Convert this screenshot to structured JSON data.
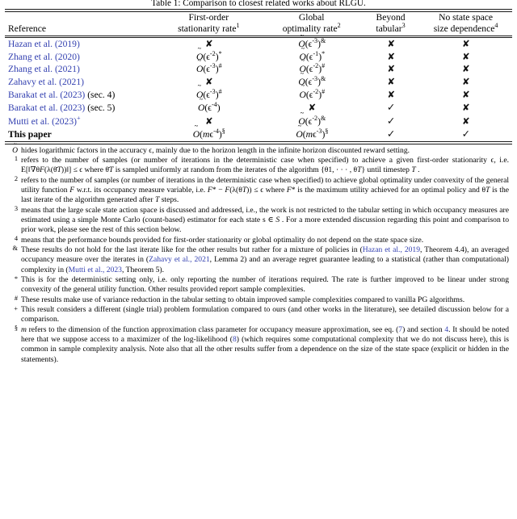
{
  "caption": "Table 1: Comparison to closest related works about RLGU.",
  "table": {
    "headers": [
      {
        "line1": "Reference",
        "line2": ""
      },
      {
        "line1": "First-order",
        "line2": "stationarity rate",
        "note": "1"
      },
      {
        "line1": "Global",
        "line2": "optimality rate",
        "note": "2"
      },
      {
        "line1": "Beyond",
        "line2": "tabular",
        "note": "3"
      },
      {
        "line1": "No state space",
        "line2": "size dependence",
        "note": "4"
      }
    ],
    "rows": [
      {
        "reference": "Hazan et al. (2019)",
        "reference_style": "link",
        "first_order": {
          "kind": "cross"
        },
        "global": {
          "kind": "rate",
          "exp": "-3",
          "note": "&"
        },
        "beyond_tabular": {
          "kind": "cross"
        },
        "no_state_dep": {
          "kind": "cross"
        }
      },
      {
        "reference": "Zhang et al. (2020)",
        "reference_style": "link",
        "first_order": {
          "kind": "rate",
          "exp": "-2",
          "note": "*"
        },
        "global": {
          "kind": "rate",
          "exp": "-1",
          "note": "*"
        },
        "beyond_tabular": {
          "kind": "cross"
        },
        "no_state_dep": {
          "kind": "cross"
        }
      },
      {
        "reference": "Zhang et al. (2021)",
        "reference_style": "link",
        "first_order": {
          "kind": "rate",
          "exp": "-3",
          "note": "#"
        },
        "global": {
          "kind": "rate",
          "exp": "-2",
          "note": "#"
        },
        "beyond_tabular": {
          "kind": "cross"
        },
        "no_state_dep": {
          "kind": "cross"
        }
      },
      {
        "reference": "Zahavy et al. (2021)",
        "reference_style": "link",
        "first_order": {
          "kind": "cross"
        },
        "global": {
          "kind": "rate",
          "exp": "-3",
          "note": "&"
        },
        "beyond_tabular": {
          "kind": "cross"
        },
        "no_state_dep": {
          "kind": "cross"
        }
      },
      {
        "reference": "Barakat et al. (2023)",
        "reference_suffix": " (sec. 4)",
        "reference_style": "link",
        "first_order": {
          "kind": "rate",
          "exp": "-3",
          "note": "#"
        },
        "global": {
          "kind": "rate",
          "exp": "-2",
          "note": "#"
        },
        "beyond_tabular": {
          "kind": "cross"
        },
        "no_state_dep": {
          "kind": "cross"
        }
      },
      {
        "reference": "Barakat et al. (2023)",
        "reference_suffix": " (sec. 5)",
        "reference_style": "link",
        "first_order": {
          "kind": "rate",
          "exp": "-4",
          "note": ""
        },
        "global": {
          "kind": "cross"
        },
        "beyond_tabular": {
          "kind": "check"
        },
        "no_state_dep": {
          "kind": "cross"
        }
      },
      {
        "reference": "Mutti et al. (2023)",
        "reference_note": "+",
        "reference_style": "link",
        "first_order": {
          "kind": "cross"
        },
        "global": {
          "kind": "rate",
          "exp": "-2",
          "note": "&"
        },
        "beyond_tabular": {
          "kind": "check"
        },
        "no_state_dep": {
          "kind": "cross"
        }
      },
      {
        "reference": "This paper",
        "reference_style": "bold",
        "first_order": {
          "kind": "rate-m",
          "exp": "-4",
          "note": "§"
        },
        "global": {
          "kind": "rate-m",
          "exp": "-3",
          "note": "§"
        },
        "beyond_tabular": {
          "kind": "check"
        },
        "no_state_dep": {
          "kind": "check"
        }
      }
    ]
  },
  "glyphs": {
    "cross": "✘",
    "check": "✓"
  },
  "notes": [
    {
      "mark": "O-tilde",
      "text": "hides logarithmic factors in the accuracy ϵ, mainly due to the horizon length in the infinite horizon discounted reward setting."
    },
    {
      "mark": "1",
      "text": "refers to the number of samples (or number of iterations in the deterministic case when specified) to achieve a given first-order stationarity ϵ, i.e. E[‖∇θF(λ(θ̄T))‖] ≤ ϵ where θ̄T is sampled uniformly at random from the iterates of the algorithm {θ1, · · · , θT} until timestep T ."
    },
    {
      "mark": "2",
      "text": "refers to the number of samples (or number of iterations in the deterministic case when specified) to achieve global optimality under convexity of the general utility function F w.r.t. its occupancy measure variable, i.e. F* − F(λ(θT)) ≤ ϵ where F* is the maximum utility achieved for an optimal policy and θT is the last iterate of the algorithm generated after T steps."
    },
    {
      "mark": "3",
      "text": "means that the large scale state action space is discussed and addressed, i.e., the work is not restricted to the tabular setting in which occupancy measures are estimated using a simple Monte Carlo (count-based) estimator for each state s ∈ S . For a more extended discussion regarding this point and comparison to prior work, please see the rest of this section below."
    },
    {
      "mark": "4",
      "text": "means that the performance bounds provided for first-order stationarity or global optimality do not depend on the state space size."
    },
    {
      "mark": "&",
      "text": "These results do not hold for the last iterate like for the other results but rather for a mixture of policies in (Hazan et al., 2019, Theorem 4.4), an averaged occupancy measure over the iterates in (Zahavy et al., 2021, Lemma 2) and an average regret guarantee leading to a statistical (rather than computational) complexity in (Mutti et al., 2023, Theorem 5)."
    },
    {
      "mark": "*",
      "text": "This is for the deterministic setting only, i.e. only reporting the number of iterations required. The rate is further improved to be linear under strong convexity of the general utility function. Other results provided report sample complexities."
    },
    {
      "mark": "#",
      "text": "These results make use of variance reduction in the tabular setting to obtain improved sample complexities compared to vanilla PG algorithms."
    },
    {
      "mark": "+",
      "text": "This result considers a different (single trial) problem formulation compared to ours (and other works in the literature), see detailed discussion below for a comparison."
    },
    {
      "mark": "§",
      "text": "m refers to the dimension of the function approximation class parameter for occupancy measure approximation, see eq. (7) and section 4. It should be noted here that we suppose access to a maximizer of the log-likelihood (8) (which requires some computational complexity that we do not discuss here), this is common in sample complexity analysis. Note also that all the other results suffer from a dependence on the size of the state space (explicit or hidden in the statements)."
    }
  ],
  "note_links": {
    "hazan": "Hazan et al., 2019",
    "zahavy": "Zahavy et al., 2021",
    "mutti": "Mutti et al., 2023",
    "eq7": "7",
    "sec4": "4",
    "eq8": "8"
  },
  "colors": {
    "link": "#3340b0",
    "text": "#000000",
    "rule": "#1a1a1a"
  }
}
